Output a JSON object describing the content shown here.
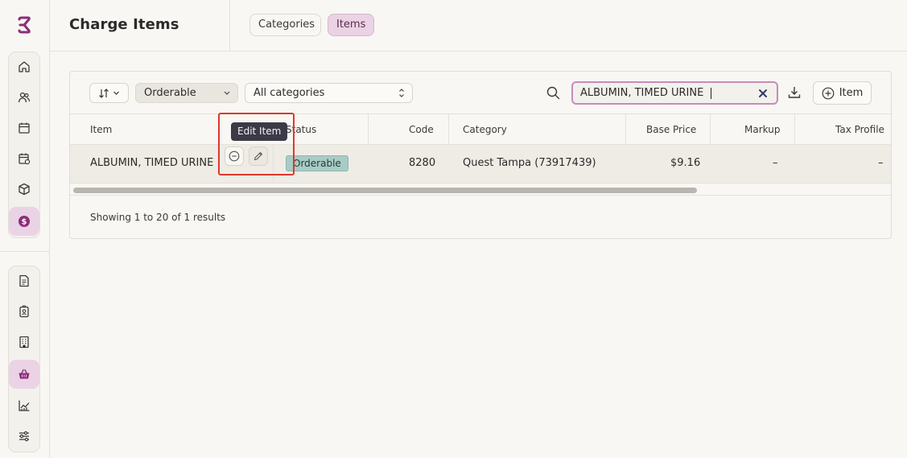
{
  "app": {
    "logo_icon": "brand-logo-icon",
    "accent_color": "#8e2c7a"
  },
  "sidebar": {
    "group1": [
      {
        "name": "home-icon"
      },
      {
        "name": "users-icon"
      },
      {
        "name": "calendar-icon"
      },
      {
        "name": "calendar-check-icon"
      },
      {
        "name": "box-icon"
      },
      {
        "name": "dollar-icon",
        "active": true
      }
    ],
    "group2": [
      {
        "name": "document-icon"
      },
      {
        "name": "badge-icon"
      },
      {
        "name": "building-icon"
      },
      {
        "name": "basket-icon",
        "active": true
      },
      {
        "name": "chart-icon"
      },
      {
        "name": "sliders-icon"
      }
    ]
  },
  "header": {
    "title": "Charge Items",
    "tabs": [
      {
        "label": "Categories",
        "active": false
      },
      {
        "label": "Items",
        "active": true
      }
    ]
  },
  "toolbar": {
    "sort_label": "↓↑",
    "status_filter": "Orderable",
    "category_filter": "All categories",
    "search_value": "ALBUMIN, TIMED URINE",
    "add_button_label": "Item"
  },
  "table": {
    "columns": [
      "Item",
      "Status",
      "Code",
      "Category",
      "Base Price",
      "Markup",
      "Tax Profile"
    ],
    "rows": [
      {
        "item": "ALBUMIN, TIMED URINE",
        "status": "Orderable",
        "code": "8280",
        "category": "Quest Tampa (73917439)",
        "base_price": "$9.16",
        "markup": "–",
        "tax_profile": "–"
      }
    ],
    "footer": "Showing 1 to 20 of 1 results"
  },
  "tooltip": {
    "text": "Edit Item"
  }
}
